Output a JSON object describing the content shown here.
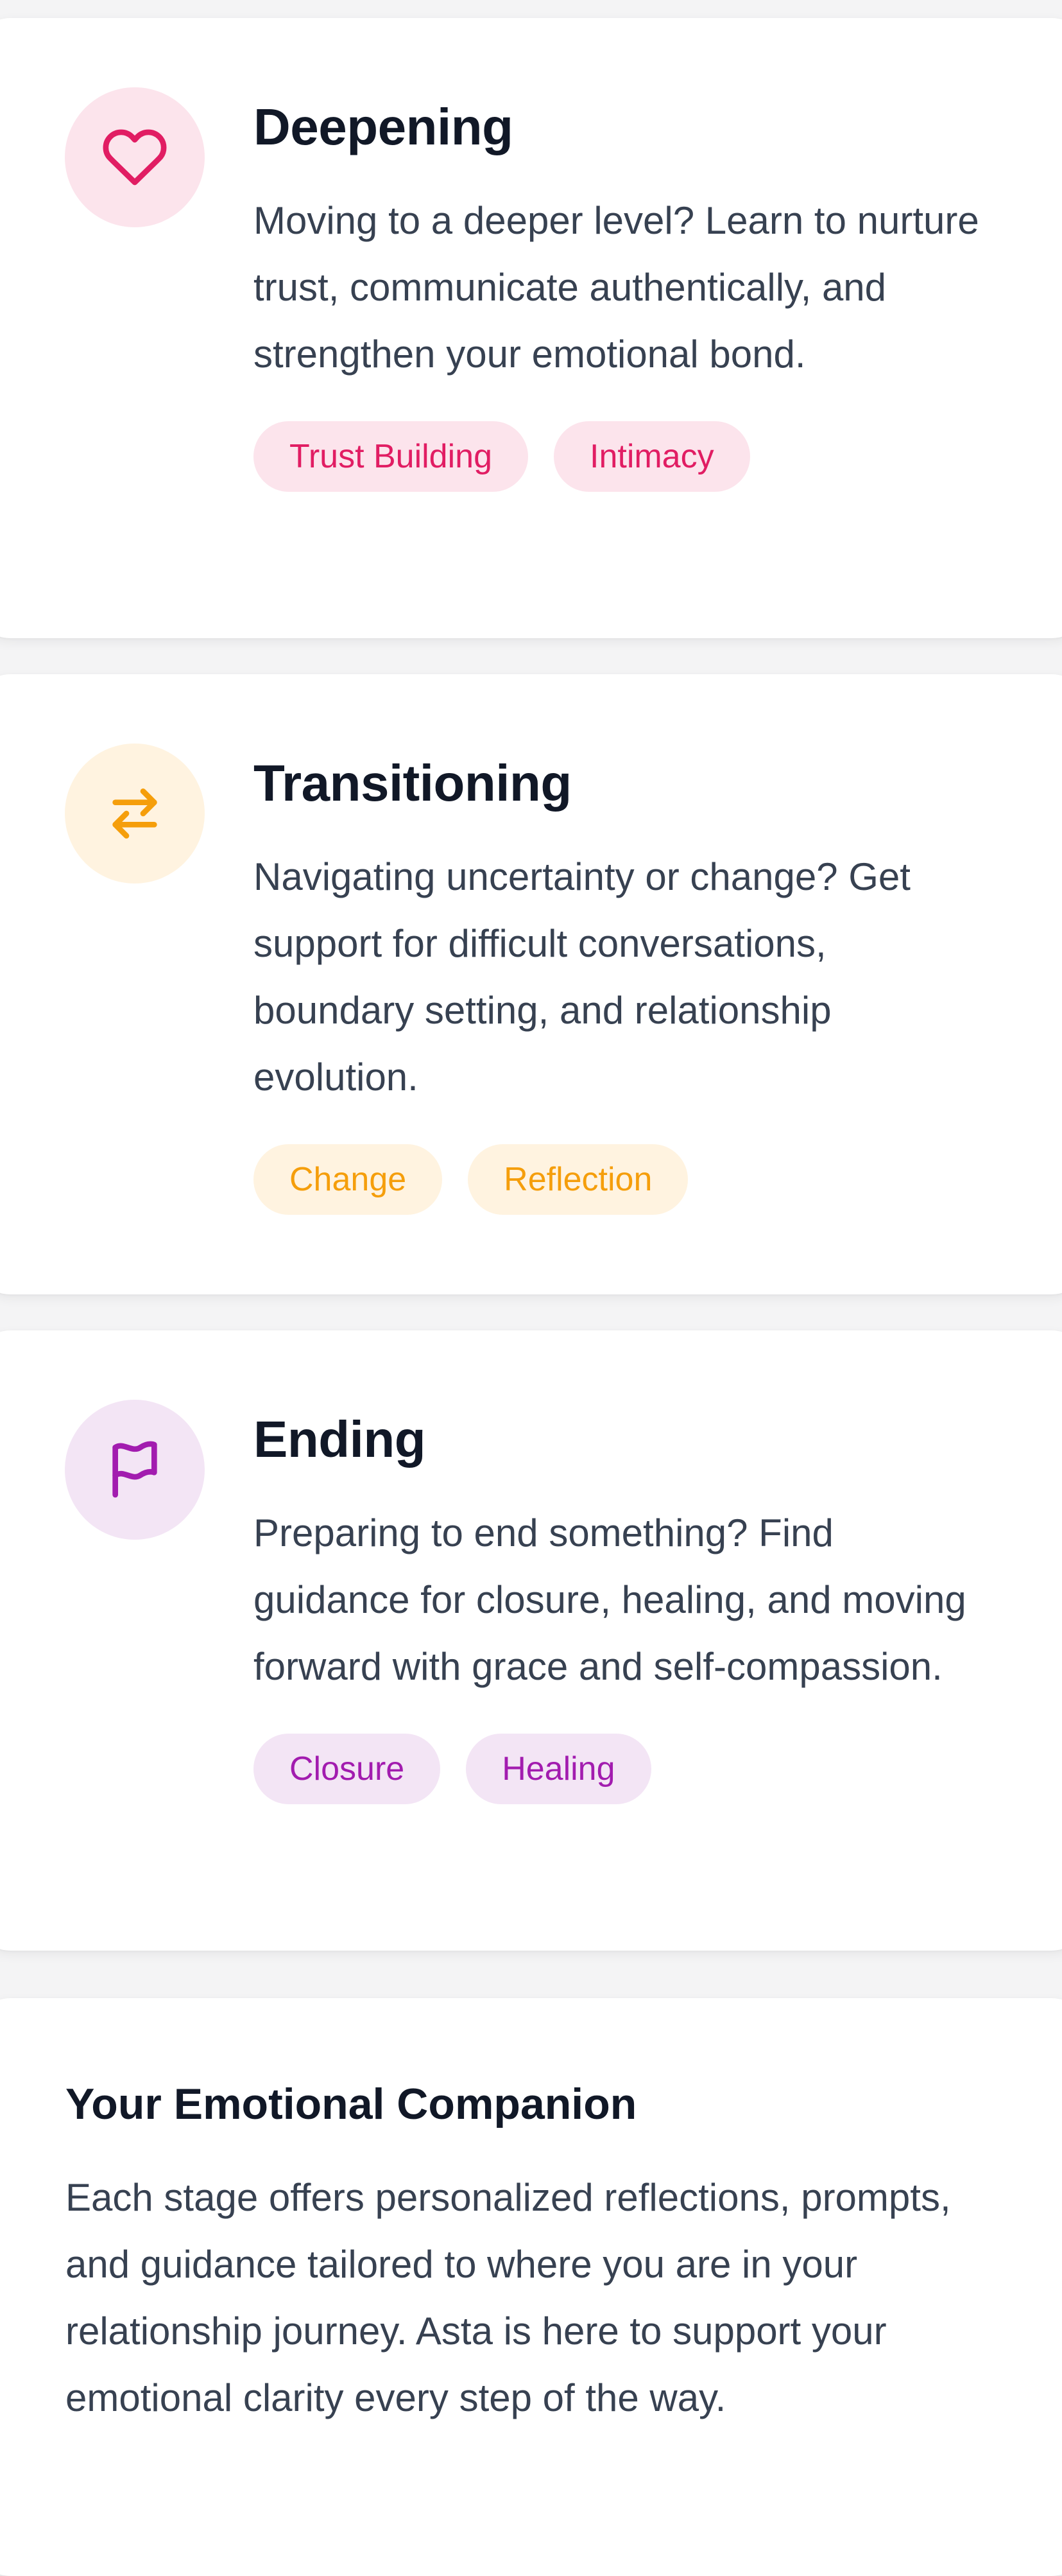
{
  "stages": [
    {
      "id": "deepening",
      "title": "Deepening",
      "description": "Moving to a deeper level? Learn to nurture trust, communicate authentically, and strengthen your emotional bond.",
      "icon": "heart-icon",
      "accent": "#e11d63",
      "icon_bg": "#fce4ec",
      "tag_bg": "#fce4ec",
      "tags": [
        "Trust Building",
        "Intimacy"
      ]
    },
    {
      "id": "transitioning",
      "title": "Transitioning",
      "description": "Navigating uncertainty or change? Get support for difficult conversations, boundary setting, and relationship evolution.",
      "icon": "arrows-swap-icon",
      "accent": "#f59e0b",
      "icon_bg": "#fff3e0",
      "tag_bg": "#fff3e0",
      "tags": [
        "Change",
        "Reflection"
      ]
    },
    {
      "id": "ending",
      "title": "Ending",
      "description": "Preparing to end something? Find guidance for closure, healing, and moving forward with grace and self-compassion.",
      "icon": "flag-icon",
      "accent": "#a21caf",
      "icon_bg": "#f3e5f5",
      "tag_bg": "#f3e5f5",
      "tags": [
        "Closure",
        "Healing"
      ]
    }
  ],
  "companion": {
    "title": "Your Emotional Companion",
    "text": "Each stage offers personalized reflections, prompts, and guidance tailored to where you are in your relationship journey. Asta is here to support your emotional clarity every step of the way."
  }
}
